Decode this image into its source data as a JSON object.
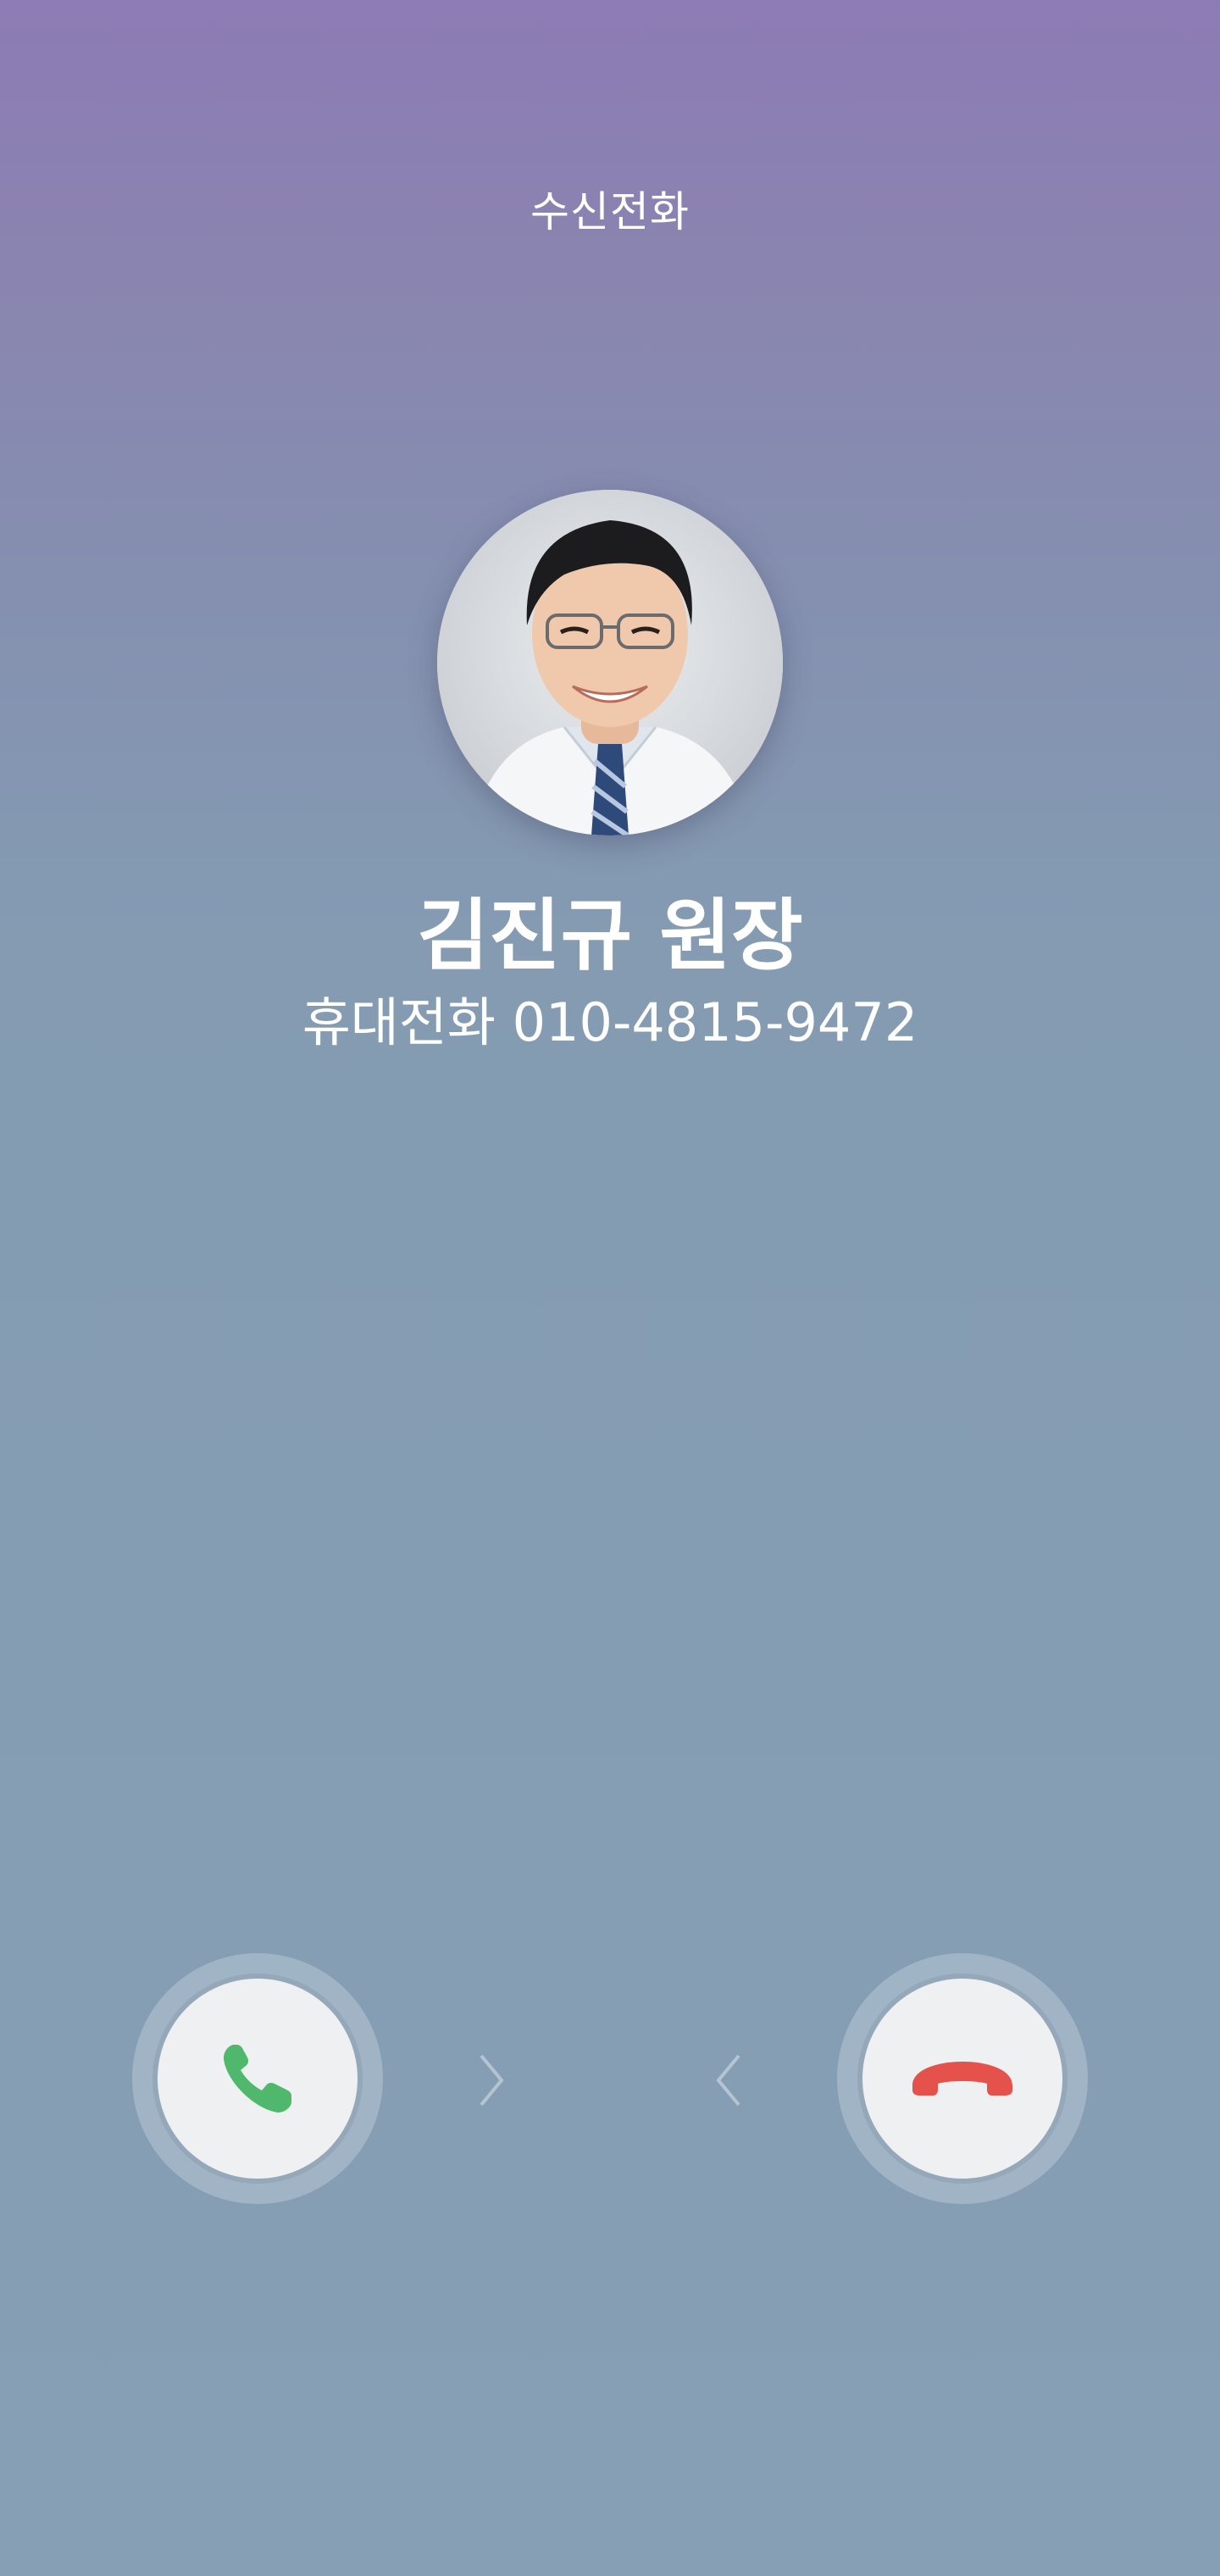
{
  "header": {
    "title": "수신전화"
  },
  "caller": {
    "name": "김진규 원장",
    "number_label": "휴대전화",
    "number": "010-4815-9472"
  },
  "actions": {
    "accept_icon": "phone-accept-icon",
    "decline_icon": "phone-decline-icon",
    "accept_color": "#4fb86c",
    "decline_color": "#e5524b"
  }
}
